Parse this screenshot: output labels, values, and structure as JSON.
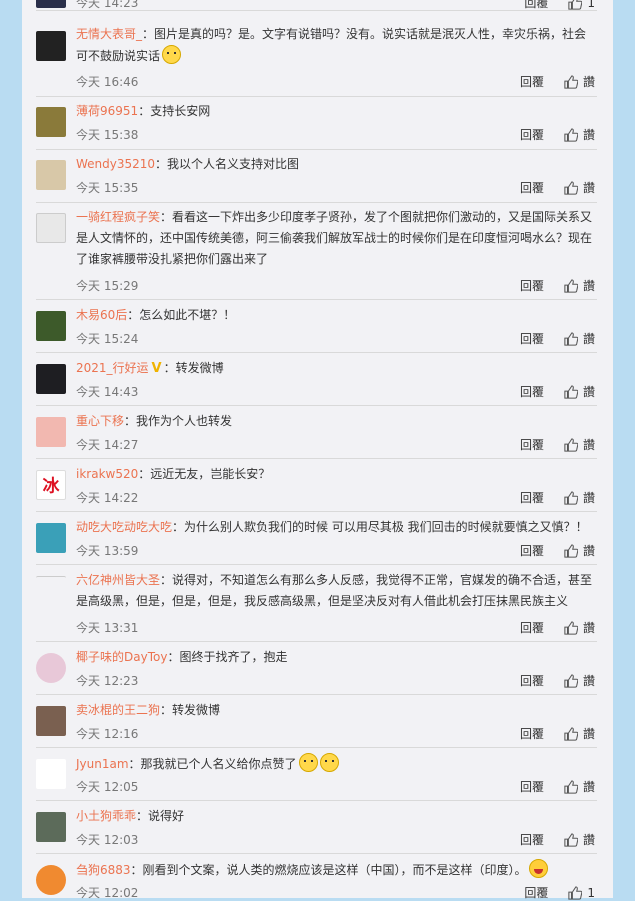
{
  "actions": {
    "reply": "回覆",
    "like": "讚"
  },
  "top_row": {
    "time": "今天 14:23",
    "reply": "回覆",
    "likes": "1"
  },
  "comments": [
    {
      "user": "无情大表哥_",
      "text": "：图片是真的吗？是。文字有说错吗？没有。说实话就是泯灭人性，幸灾乐祸，社会可不鼓励说实话",
      "time": "今天 16:46"
    },
    {
      "user": "薄荷96951",
      "text": "：支持长安网",
      "time": "今天 15:38"
    },
    {
      "user": "Wendy35210",
      "text": "：我以个人名义支持对比图",
      "time": "今天 15:35"
    },
    {
      "user": "一骑红程疯子笑",
      "text": "：看看这一下炸出多少印度孝子贤孙，发了个图就把你们激动的，又是国际关系又是人文情怀的，还中国传统美德，阿三偷袭我们解放军战士的时候你们是在印度恒河喝水么？现在了谁家裤腰带没扎紧把你们露出来了",
      "time": "今天 15:29"
    },
    {
      "user": "木易60后",
      "text": "：怎么如此不堪？！",
      "time": "今天 15:24"
    },
    {
      "user": "2021_行好运",
      "text": "：转发微博",
      "time": "今天 14:43"
    },
    {
      "user": "重心下移",
      "text": "：我作为个人也转发",
      "time": "今天 14:27"
    },
    {
      "user": "ikrakw520",
      "text": "：远近无友，岂能长安？",
      "time": "今天 14:22"
    },
    {
      "user": "动吃大吃动吃大吃",
      "text": "：为什么别人欺负我们的时候 可以用尽其极 我们回击的时候就要慎之又慎？！",
      "time": "今天 13:59"
    },
    {
      "user": "六亿神州皆大圣",
      "text": "：说得对，不知道怎么有那么多人反感，我觉得不正常，官媒发的确不合适，甚至是高级黑，但是，但是，但是，我反感高级黑，但是坚决反对有人借此机会打压抹黑民族主义",
      "time": "今天 13:31"
    },
    {
      "user": "椰子味的DayToy",
      "text": "：图终于找齐了，抱走",
      "time": "今天 12:23"
    },
    {
      "user": "卖冰棍的王二狗",
      "text": "：转发微博",
      "time": "今天 12:16"
    },
    {
      "user": "Jyun1am",
      "text": "：那我就已个人名义给你点赞了",
      "time": "今天 12:05"
    },
    {
      "user": "小土狗乖乖",
      "text": "：说得好",
      "time": "今天 12:03"
    },
    {
      "user": "刍狗6883",
      "text": "：刚看到个文案，说人类的燃烧应该是这样（中国），而不是这样（印度）。",
      "time": "今天 12:02",
      "likes": "1"
    }
  ]
}
